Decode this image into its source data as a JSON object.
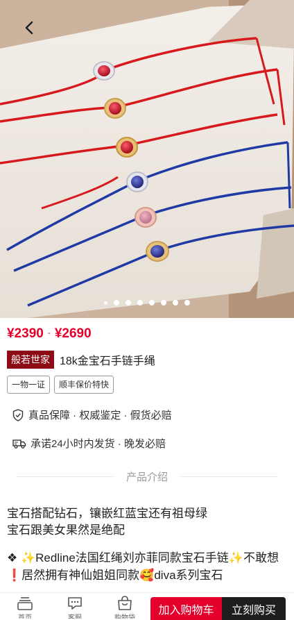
{
  "hero": {
    "back_icon": "chevron-left-icon",
    "carousel_count": 8,
    "active_index": 0
  },
  "price": {
    "low": "¥2390",
    "separator": "-",
    "high": "¥2690",
    "color": "#e4002b"
  },
  "product": {
    "brand_tag": "般若世家",
    "title": "18k金宝石手链手绳",
    "brand_color": "#8c0b14"
  },
  "badges": [
    "一物一证",
    "顺丰保价特快"
  ],
  "guarantee": {
    "icon": "shield-check-icon",
    "text": "真品保障 · 权威鉴定 · 假货必赔"
  },
  "shipping": {
    "icon": "truck-icon",
    "text": "承诺24小时内发货 · 晚发必赔"
  },
  "section": {
    "title": "产品介绍"
  },
  "description": {
    "line1": "宝石搭配钻石，镶嵌红蓝宝还有祖母绿",
    "line2": "宝石跟美女果然是绝配",
    "para": "❖ ✨Redline法国红绳刘亦菲同款宝石手链✨不敢想❗居然拥有神仙姐姐同款🥰diva系列宝石"
  },
  "bottom_bar": {
    "nav": [
      {
        "icon": "home-icon",
        "label": "首页"
      },
      {
        "icon": "chat-icon",
        "label": "客服"
      },
      {
        "icon": "bag-icon",
        "label": "购物袋"
      }
    ],
    "add_to_cart": "加入购物车",
    "buy_now": "立刻购买",
    "buy_color": "#1e1e1e"
  }
}
